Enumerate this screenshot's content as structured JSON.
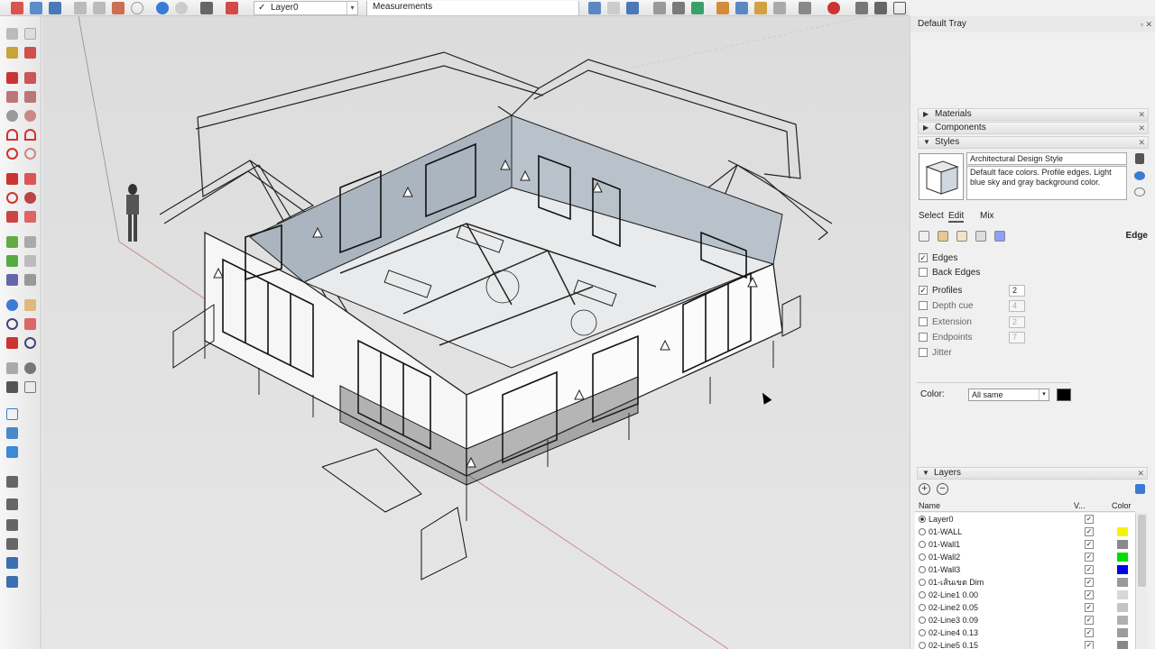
{
  "toolbar": {
    "layer_value": "Layer0",
    "layer_check": "✓",
    "dropdown_arrow": "▾",
    "measurements_label": "Measurements"
  },
  "tray": {
    "title": "Default Tray",
    "title_buttons": "▫ ✕"
  },
  "panels": {
    "materials": "Materials",
    "components": "Components",
    "styles": "Styles",
    "layers": "Layers",
    "collapsed_tri": "▶",
    "expanded_tri": "▼",
    "close": "✕"
  },
  "styles": {
    "style_name": "Architectural Design Style",
    "style_description": "Default face colors. Profile edges. Light blue sky and gray background color.",
    "tabs": [
      "Select",
      "Edit",
      "Mix"
    ],
    "active_tab": "Edit",
    "section_label": "Edge",
    "options": [
      {
        "label": "Edges",
        "checked": true,
        "value": null
      },
      {
        "label": "Back Edges",
        "checked": false,
        "value": null
      },
      {
        "label": "Profiles",
        "checked": true,
        "value": "2"
      },
      {
        "label": "Depth cue",
        "checked": false,
        "value": "4"
      },
      {
        "label": "Extension",
        "checked": false,
        "value": "2"
      },
      {
        "label": "Endpoints",
        "checked": false,
        "value": "7"
      },
      {
        "label": "Jitter",
        "checked": false,
        "value": null
      }
    ],
    "color_label": "Color:",
    "color_select": "All same",
    "color_value": "#000000"
  },
  "layers": {
    "add": "+",
    "remove": "−",
    "col_name": "Name",
    "col_visible": "V...",
    "col_color": "Color",
    "check_mark": "✓",
    "rows": [
      {
        "name": "Layer0",
        "active": true,
        "color": "#ffffff"
      },
      {
        "name": "01-WALL",
        "active": false,
        "color": "#f5f500"
      },
      {
        "name": "01-Wall1",
        "active": false,
        "color": "#8a8a8a"
      },
      {
        "name": "01-Wall2",
        "active": false,
        "color": "#00dd00"
      },
      {
        "name": "01-Wall3",
        "active": false,
        "color": "#0000ee"
      },
      {
        "name": "01-เส้นเขต Dim",
        "active": false,
        "color": "#9a9a9a"
      },
      {
        "name": "02-Line1 0.00",
        "active": false,
        "color": "#d8d8d8"
      },
      {
        "name": "02-Line2 0.05",
        "active": false,
        "color": "#c4c4c4"
      },
      {
        "name": "02-Line3 0.09",
        "active": false,
        "color": "#b0b0b0"
      },
      {
        "name": "02-Line4 0.13",
        "active": false,
        "color": "#9c9c9c"
      },
      {
        "name": "02-Line5 0.15",
        "active": false,
        "color": "#888888"
      }
    ]
  }
}
